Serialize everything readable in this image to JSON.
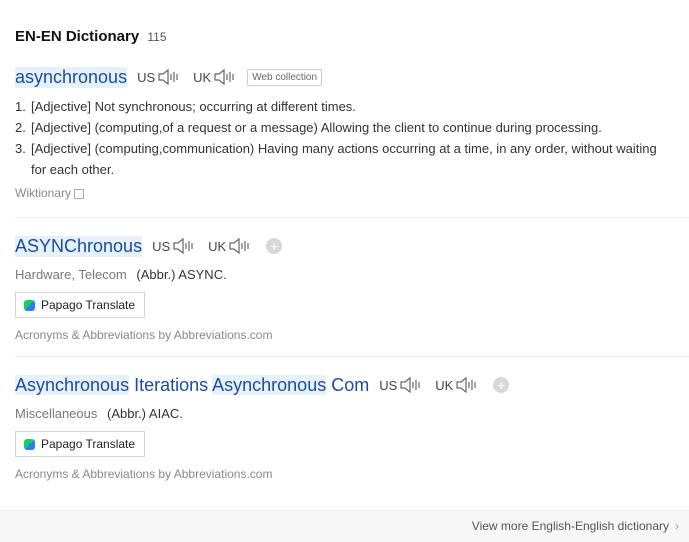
{
  "header": {
    "title": "EN-EN Dictionary",
    "count": "115"
  },
  "entry1": {
    "word": "asynchronous",
    "us_label": "US",
    "uk_label": "UK",
    "tag": "Web collection",
    "definitions": [
      {
        "num": "1.",
        "text": "[Adjective] Not synchronous; occurring at different times."
      },
      {
        "num": "2.",
        "text": "[Adjective] (computing,of a request or a message) Allowing the client to continue during processing."
      },
      {
        "num": "3.",
        "text": "[Adjective] (computing,communication) Having many actions occurring at a time, in any order, without waiting for each other."
      }
    ],
    "source": "Wiktionary"
  },
  "entry2": {
    "word_part1": "ASYNChronous",
    "us_label": "US",
    "uk_label": "UK",
    "field": "Hardware, Telecom",
    "abbr": "(Abbr.) ASYNC.",
    "translate_label": "Papago Translate",
    "source": "Acronyms & Abbreviations by Abbreviations.com"
  },
  "entry3": {
    "word_part1": "Asynchronous",
    "word_part2": " Iterations ",
    "word_part3": "Asynchronous",
    "word_part4": " Com",
    "us_label": "US",
    "uk_label": "UK",
    "field": "Miscellaneous",
    "abbr": "(Abbr.) AIAC.",
    "translate_label": "Papago Translate",
    "source": "Acronyms & Abbreviations by Abbreviations.com"
  },
  "footer": {
    "more_label": "View more English-English dictionary",
    "chevron": "›"
  },
  "colors": {
    "link": "#1a4da1",
    "highlight": "#e6f1fc"
  }
}
